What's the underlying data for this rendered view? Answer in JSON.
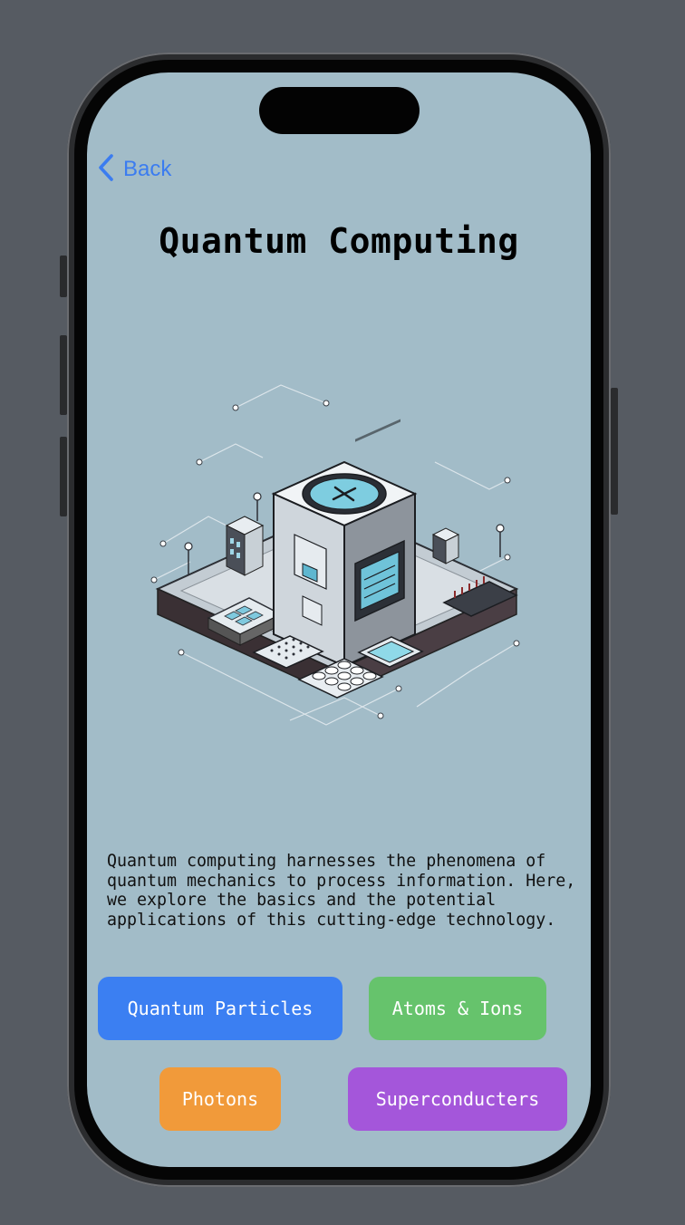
{
  "nav": {
    "back_label": "Back"
  },
  "page": {
    "title": "Quantum Computing",
    "description": "Quantum computing harnesses the phenomena of\nquantum mechanics to process information. Here,\nwe explore the basics and the potential\napplications of this cutting-edge technology."
  },
  "illustration": {
    "icon": "quantum-computer-illustration"
  },
  "categories": [
    {
      "label": "Quantum Particles",
      "color": "#3b7ff2"
    },
    {
      "label": "Atoms & Ions",
      "color": "#66c36c"
    },
    {
      "label": "Photons",
      "color": "#f19a3a"
    },
    {
      "label": "Superconducters",
      "color": "#a456da"
    }
  ],
  "colors": {
    "screen_bg": "#a2bcc8",
    "accent": "#3b7cf0",
    "backdrop": "#565b62"
  }
}
